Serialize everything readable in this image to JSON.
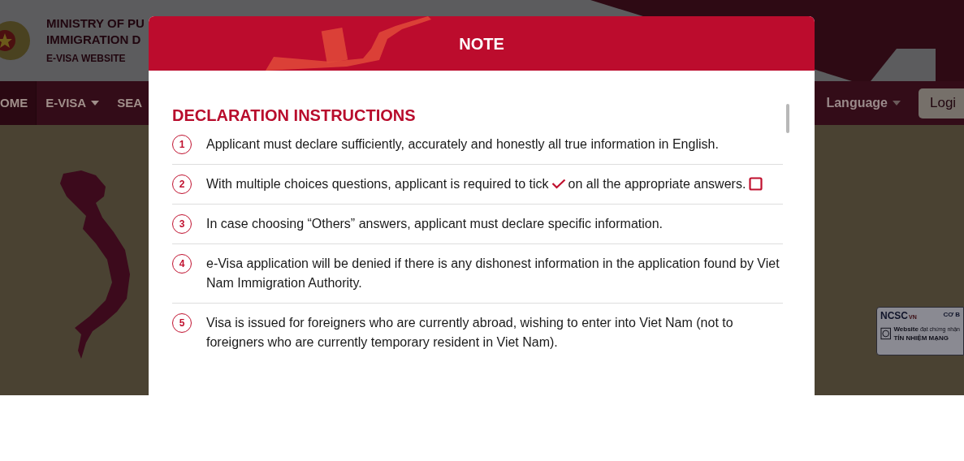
{
  "site_header": {
    "title_lines": [
      "MINISTRY OF PU",
      "IMMIGRATION D"
    ],
    "subtitle": "E-VISA WEBSITE"
  },
  "nav": {
    "items": [
      {
        "label": "OME",
        "dropdown": false,
        "selected": true
      },
      {
        "label": "E-VISA",
        "dropdown": true,
        "selected": false
      },
      {
        "label": "SEA",
        "dropdown": false,
        "selected": false
      }
    ],
    "language": "Language",
    "login": "Logi"
  },
  "trust_badge": {
    "brand": "NCSC",
    "brand_suffix": "VN",
    "label": "CƠ B",
    "line_1": "Website",
    "line_1_small": "đạt chứng nhận",
    "line_2": "TÍN NHIỆM MẠNG"
  },
  "modal": {
    "title": "NOTE",
    "heading": "DECLARATION INSTRUCTIONS",
    "items": [
      {
        "number": "1",
        "segments": [
          "Applicant must declare sufficiently, accurately and honestly all true information in English."
        ]
      },
      {
        "number": "2",
        "segments": [
          "With multiple choices questions, applicant is required to tick",
          "on all the appropriate answers."
        ],
        "kind": "icons"
      },
      {
        "number": "3",
        "segments": [
          "In case choosing “Others” answers, applicant must declare specific information."
        ]
      },
      {
        "number": "4",
        "segments": [
          "e-Visa application will be denied if there is any dishonest information in the application found by Viet Nam Immigration Authority."
        ]
      },
      {
        "number": "5",
        "segments": [
          "Visa is issued for foreigners who are currently abroad, wishing to enter into Viet Nam (not to foreigners who are currently temporary resident in Viet Nam)."
        ]
      }
    ]
  }
}
